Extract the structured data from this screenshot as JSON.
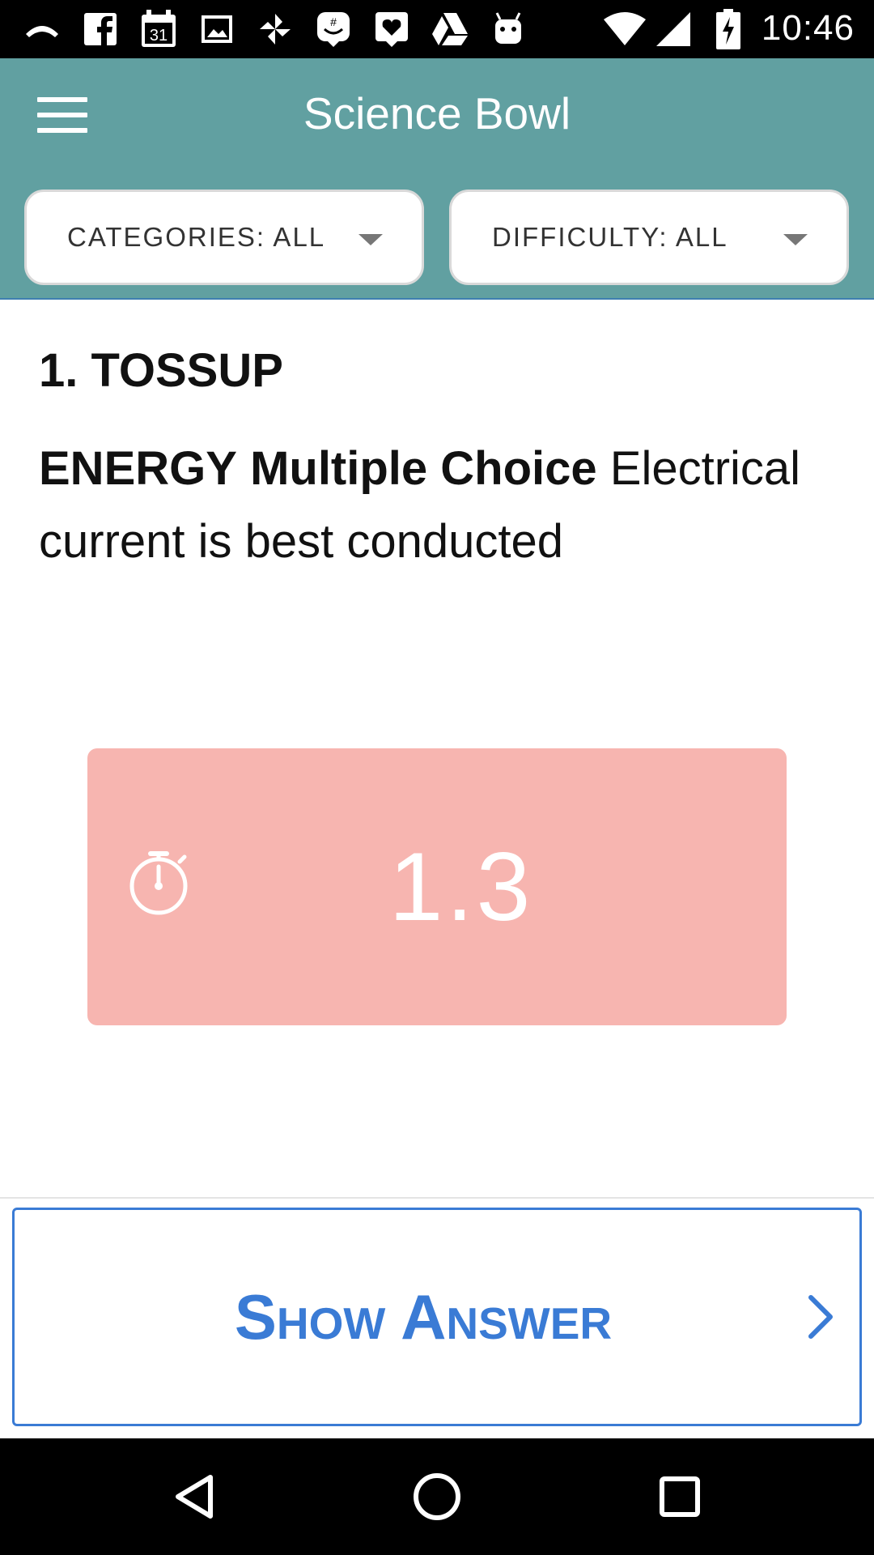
{
  "status_bar": {
    "time": "10:46",
    "icons": [
      "missed-call-icon",
      "facebook-icon",
      "calendar-icon",
      "gallery-icon",
      "pinwheel-icon",
      "messenger-bot-icon",
      "heart-message-icon",
      "drive-icon",
      "android-icon",
      "wifi-icon",
      "signal-icon",
      "battery-charging-icon"
    ],
    "calendar_day": "31"
  },
  "app_bar": {
    "title": "Science Bowl",
    "categories_filter": "CATEGORIES: ALL",
    "difficulty_filter": "DIFFICULTY: ALL",
    "background_color": "#61a0a1"
  },
  "question": {
    "header": "1. TOSSUP",
    "category": "ENERGY",
    "type": "Multiple Choice",
    "text": "Electrical current is best conducted"
  },
  "timer": {
    "value": "1.3",
    "icon": "stopwatch-icon",
    "background_color": "#f7b5b0"
  },
  "actions": {
    "show_answer_label": "Show Answer",
    "accent_color": "#3a7bd5"
  },
  "nav_bar": {
    "buttons": [
      "back-icon",
      "home-icon",
      "recents-icon"
    ]
  }
}
